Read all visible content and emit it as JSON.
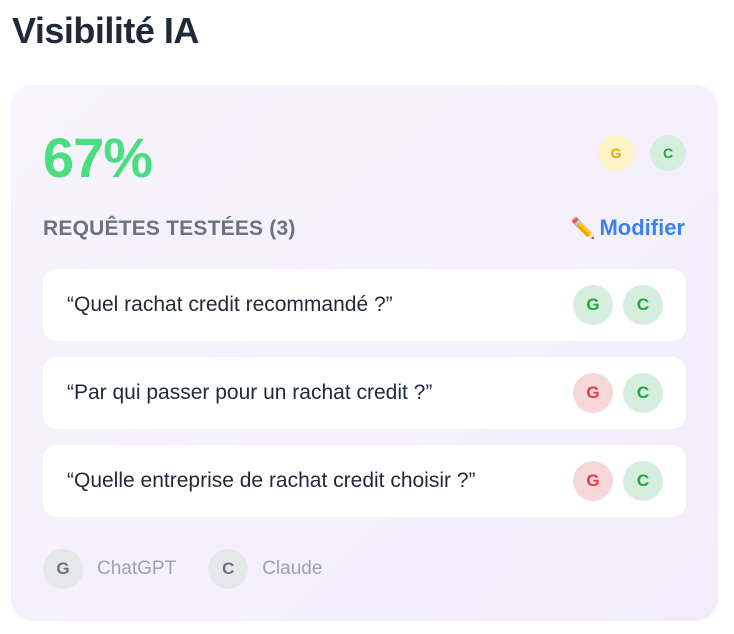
{
  "page": {
    "title": "Visibilité IA"
  },
  "card": {
    "score": "67%",
    "header_badges": [
      {
        "letter": "G",
        "status": "partial",
        "color": "#e6a700"
      },
      {
        "letter": "C",
        "status": "visible",
        "color": "#22a447"
      }
    ],
    "section_title": "REQUÊTES TESTÉES (3)",
    "edit_label": "Modifier",
    "edit_icon": "pencil-icon",
    "queries": [
      {
        "text": "“Quel rachat credit recommandé ?”",
        "badges": [
          {
            "letter": "G",
            "status": "visible"
          },
          {
            "letter": "C",
            "status": "visible"
          }
        ]
      },
      {
        "text": "“Par qui passer pour un rachat credit ?”",
        "badges": [
          {
            "letter": "G",
            "status": "not-visible"
          },
          {
            "letter": "C",
            "status": "visible"
          }
        ]
      },
      {
        "text": "“Quelle entreprise de rachat credit choisir ?”",
        "badges": [
          {
            "letter": "G",
            "status": "not-visible"
          },
          {
            "letter": "C",
            "status": "visible"
          }
        ]
      }
    ],
    "legend": [
      {
        "letter": "G",
        "label": "ChatGPT"
      },
      {
        "letter": "C",
        "label": "Claude"
      }
    ]
  },
  "colors": {
    "score": "#4ade80",
    "link": "#3b82f6",
    "visible": "#22a447",
    "not_visible": "#e53945",
    "partial": "#e6a700"
  }
}
